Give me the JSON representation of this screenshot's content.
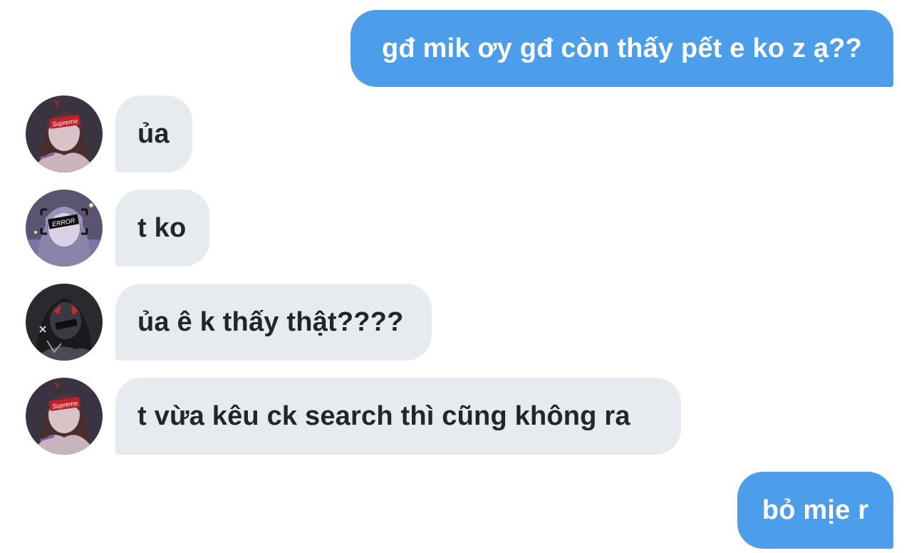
{
  "conversation": {
    "messages": [
      {
        "direction": "outgoing",
        "text": "gđ mik ơy gđ còn thấy pết e ko z ạ??"
      },
      {
        "direction": "incoming",
        "avatar": "avatar-supreme-girl",
        "text": "ủa"
      },
      {
        "direction": "incoming",
        "avatar": "avatar-error-girl",
        "text": "t ko"
      },
      {
        "direction": "incoming",
        "avatar": "avatar-dark-boy",
        "text": "ủa ê k thấy thật????"
      },
      {
        "direction": "incoming",
        "avatar": "avatar-supreme-girl",
        "text": "t vừa kêu ck search thì cũng không ra"
      },
      {
        "direction": "outgoing",
        "text": "bỏ mịe r"
      }
    ],
    "avatar_badges": {
      "supreme": "Supreme",
      "error": "ERROR"
    }
  },
  "colors": {
    "outgoing_bubble": "#4c9eea",
    "incoming_bubble": "#e7eaee",
    "incoming_text": "#22262b",
    "outgoing_text": "#ffffff"
  }
}
